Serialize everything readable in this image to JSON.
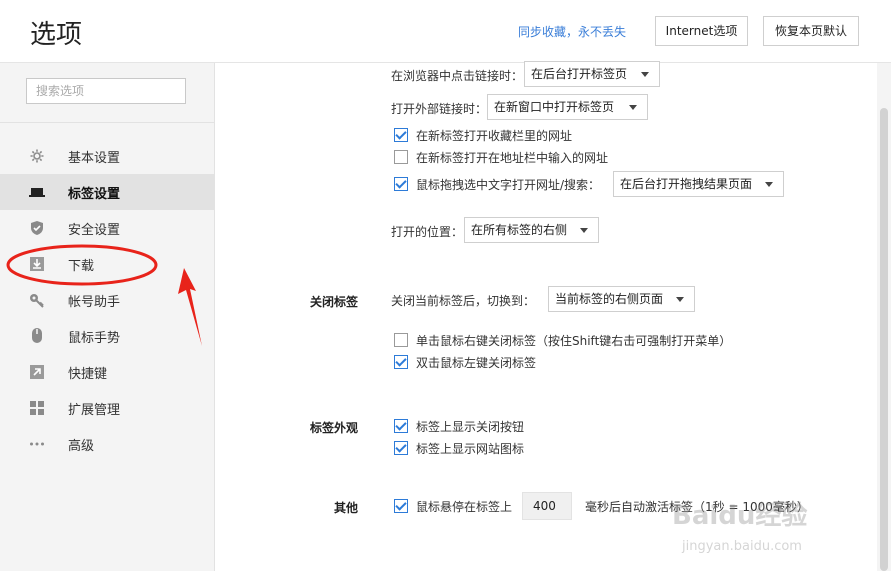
{
  "header": {
    "title": "选项",
    "sync_link": "同步收藏，永不丢失",
    "internet_options_label": "Internet选项",
    "restore_defaults_label": "恢复本页默认"
  },
  "sidebar": {
    "search_placeholder": "搜索选项",
    "items": [
      {
        "label": "基本设置",
        "icon": "gear-icon"
      },
      {
        "label": "标签设置",
        "icon": "tab-icon",
        "active": true
      },
      {
        "label": "安全设置",
        "icon": "shield-check-icon"
      },
      {
        "label": "下载",
        "icon": "download-icon"
      },
      {
        "label": "帐号助手",
        "icon": "key-icon"
      },
      {
        "label": "鼠标手势",
        "icon": "mouse-icon"
      },
      {
        "label": "快捷键",
        "icon": "shortcut-arrow-icon"
      },
      {
        "label": "扩展管理",
        "icon": "grid-icon"
      },
      {
        "label": "高级",
        "icon": "more-dots-icon"
      }
    ]
  },
  "tabs_section": {
    "middle_click_label": "在浏览器中点击链接时：",
    "middle_click_value": "在后台打开标签页",
    "external_link_label": "打开外部链接时：",
    "external_link_value": "在新窗口中打开标签页",
    "open_bookmarks_new_tab": {
      "label": "在新标签打开收藏栏里的网址",
      "checked": true
    },
    "open_addressbar_new_tab": {
      "label": "在新标签打开在地址栏中输入的网址",
      "checked": false
    },
    "drag_text_open": {
      "label": "鼠标拖拽选中文字打开网址/搜索：",
      "checked": true
    },
    "drag_text_value": "在后台打开拖拽结果页面",
    "open_position_label": "打开的位置：",
    "open_position_value": "在所有标签的右侧"
  },
  "close_tab_section": {
    "title": "关闭标签",
    "after_close_label": "关闭当前标签后，切换到：",
    "after_close_value": "当前标签的右侧页面",
    "right_click_close": {
      "label": "单击鼠标右键关闭标签（按住Shift键右击可强制打开菜单）",
      "checked": false
    },
    "double_click_close": {
      "label": "双击鼠标左键关闭标签",
      "checked": true
    }
  },
  "appearance_section": {
    "title": "标签外观",
    "show_close_button": {
      "label": "标签上显示关闭按钮",
      "checked": true
    },
    "show_site_icon": {
      "label": "标签上显示网站图标",
      "checked": true
    }
  },
  "other_section": {
    "title": "其他",
    "hover_activate": {
      "label": "鼠标悬停在标签上",
      "checked": true
    },
    "hover_delay_value": "400",
    "hover_suffix": "毫秒后自动激活标签（1秒 = 1000毫秒）"
  },
  "colors": {
    "accent": "#2d7bd8",
    "link": "#3a7ed8",
    "annotation_red": "#e8231a",
    "sidebar_active": "#e2e2e2"
  },
  "watermark": {
    "text": "Baidu经验",
    "url_text": "jingyan.baidu.com"
  }
}
